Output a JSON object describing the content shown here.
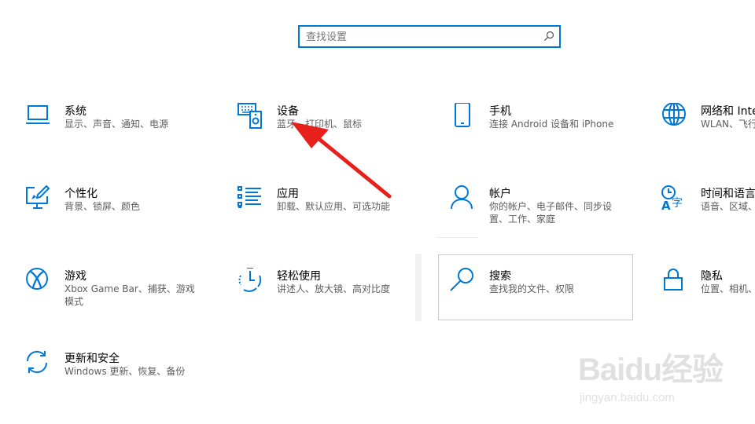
{
  "search": {
    "placeholder": "查找设置"
  },
  "tiles": [
    {
      "title": "系统",
      "desc": "显示、声音、通知、电源",
      "icon": "laptop-icon"
    },
    {
      "title": "设备",
      "desc": "蓝牙、打印机、鼠标",
      "icon": "keyboard-speaker-icon"
    },
    {
      "title": "手机",
      "desc": "连接 Android 设备和 iPhone",
      "icon": "phone-icon"
    },
    {
      "title": "网络和 Internet",
      "desc": "WLAN、飞行模式",
      "icon": "globe-icon"
    },
    {
      "title": "个性化",
      "desc": "背景、锁屏、颜色",
      "icon": "paintbrush-monitor-icon"
    },
    {
      "title": "应用",
      "desc": "卸载、默认应用、可选功能",
      "icon": "app-list-icon"
    },
    {
      "title": "帐户",
      "desc": "你的帐户、电子邮件、同步设置、工作、家庭",
      "icon": "person-icon"
    },
    {
      "title": "时间和语言",
      "desc": "语音、区域、日期",
      "icon": "time-language-icon"
    },
    {
      "title": "游戏",
      "desc": "Xbox Game Bar、捕获、游戏模式",
      "icon": "xbox-icon"
    },
    {
      "title": "轻松使用",
      "desc": "讲述人、放大镜、高对比度",
      "icon": "ease-of-access-icon"
    },
    {
      "title": "搜索",
      "desc": "查找我的文件、权限",
      "icon": "search-icon"
    },
    {
      "title": "隐私",
      "desc": "位置、相机、麦克风",
      "icon": "lock-icon"
    },
    {
      "title": "更新和安全",
      "desc": "Windows 更新、恢复、备份",
      "icon": "sync-icon"
    }
  ],
  "watermark": {
    "brand": "Baidu经验",
    "url": "jingyan.baidu.com"
  },
  "colors": {
    "accent": "#0078d7",
    "arrow": "#e8201c"
  }
}
